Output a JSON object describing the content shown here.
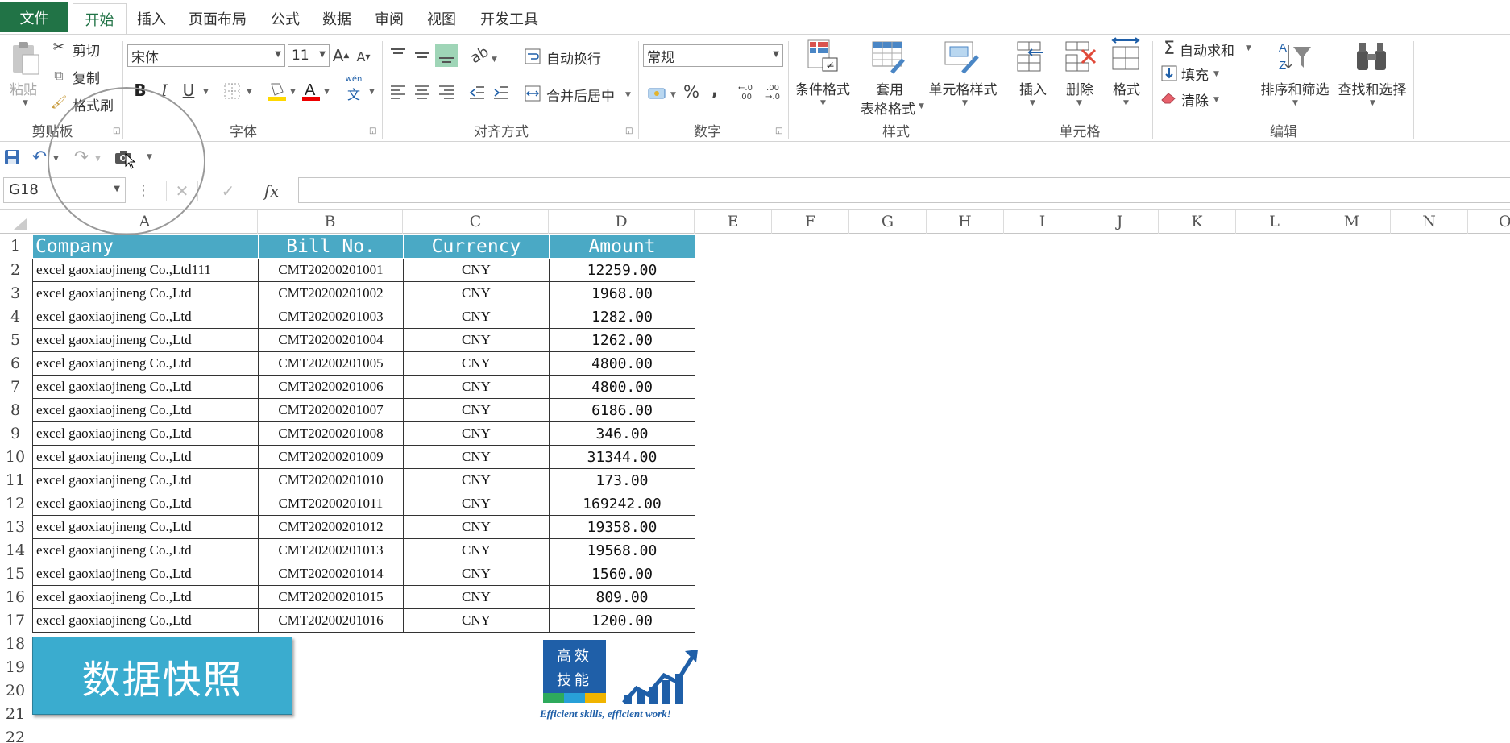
{
  "tabs": {
    "file": "文件",
    "home": "开始",
    "insert": "插入",
    "page_layout": "页面布局",
    "formulas": "公式",
    "data": "数据",
    "review": "审阅",
    "view": "视图",
    "developer": "开发工具"
  },
  "ribbon": {
    "clipboard": {
      "paste": "粘贴",
      "cut": "剪切",
      "copy": "复制",
      "format_painter": "格式刷",
      "label": "剪贴板"
    },
    "font": {
      "name": "宋体",
      "size": "11",
      "label": "字体",
      "phonetic_top": "wén",
      "phonetic_bottom": "文"
    },
    "alignment": {
      "wrap_text": "自动换行",
      "merge_center": "合并后居中",
      "label": "对齐方式"
    },
    "number": {
      "format": "常规",
      "label": "数字"
    },
    "styles": {
      "conditional": "条件格式",
      "format_table_1": "套用",
      "format_table_2": "表格格式",
      "cell_styles": "单元格样式",
      "label": "样式"
    },
    "cells": {
      "insert": "插入",
      "delete": "删除",
      "format": "格式",
      "label": "单元格"
    },
    "editing": {
      "autosum": "自动求和",
      "fill": "填充",
      "clear": "清除",
      "sort_filter": "排序和筛选",
      "find_select": "查找和选择",
      "label": "编辑"
    }
  },
  "formula_bar": {
    "name_box": "G18",
    "fx": "fx",
    "value": ""
  },
  "columns": [
    "A",
    "B",
    "C",
    "D",
    "E",
    "F",
    "G",
    "H",
    "I",
    "J",
    "K",
    "L",
    "M",
    "N",
    "O"
  ],
  "rows": [
    "1",
    "2",
    "3",
    "4",
    "5",
    "6",
    "7",
    "8",
    "9",
    "10",
    "11",
    "12",
    "13",
    "14",
    "15",
    "16",
    "17",
    "18",
    "19",
    "20",
    "21",
    "22"
  ],
  "table": {
    "headers": [
      "Company",
      "Bill No.",
      "Currency",
      "Amount"
    ],
    "rows": [
      [
        "excel gaoxiaojineng Co.,Ltd111",
        "CMT20200201001",
        "CNY",
        "12259.00"
      ],
      [
        "excel gaoxiaojineng Co.,Ltd",
        "CMT20200201002",
        "CNY",
        "1968.00"
      ],
      [
        "excel gaoxiaojineng Co.,Ltd",
        "CMT20200201003",
        "CNY",
        "1282.00"
      ],
      [
        "excel gaoxiaojineng Co.,Ltd",
        "CMT20200201004",
        "CNY",
        "1262.00"
      ],
      [
        "excel gaoxiaojineng Co.,Ltd",
        "CMT20200201005",
        "CNY",
        "4800.00"
      ],
      [
        "excel gaoxiaojineng Co.,Ltd",
        "CMT20200201006",
        "CNY",
        "4800.00"
      ],
      [
        "excel gaoxiaojineng Co.,Ltd",
        "CMT20200201007",
        "CNY",
        "6186.00"
      ],
      [
        "excel gaoxiaojineng Co.,Ltd",
        "CMT20200201008",
        "CNY",
        "346.00"
      ],
      [
        "excel gaoxiaojineng Co.,Ltd",
        "CMT20200201009",
        "CNY",
        "31344.00"
      ],
      [
        "excel gaoxiaojineng Co.,Ltd",
        "CMT20200201010",
        "CNY",
        "173.00"
      ],
      [
        "excel gaoxiaojineng Co.,Ltd",
        "CMT20200201011",
        "CNY",
        "169242.00"
      ],
      [
        "excel gaoxiaojineng Co.,Ltd",
        "CMT20200201012",
        "CNY",
        "19358.00"
      ],
      [
        "excel gaoxiaojineng Co.,Ltd",
        "CMT20200201013",
        "CNY",
        "19568.00"
      ],
      [
        "excel gaoxiaojineng Co.,Ltd",
        "CMT20200201014",
        "CNY",
        "1560.00"
      ],
      [
        "excel gaoxiaojineng Co.,Ltd",
        "CMT20200201015",
        "CNY",
        "809.00"
      ],
      [
        "excel gaoxiaojineng Co.,Ltd",
        "CMT20200201016",
        "CNY",
        "1200.00"
      ]
    ]
  },
  "snapshot_button": "数据快照",
  "logo": {
    "line1": "高效",
    "line2": "技能",
    "tagline": "Efficient skills, efficient work!"
  },
  "colors": {
    "excel_green": "#217346",
    "header_fill": "#4aa9c5",
    "button_fill": "#3aaccf"
  }
}
